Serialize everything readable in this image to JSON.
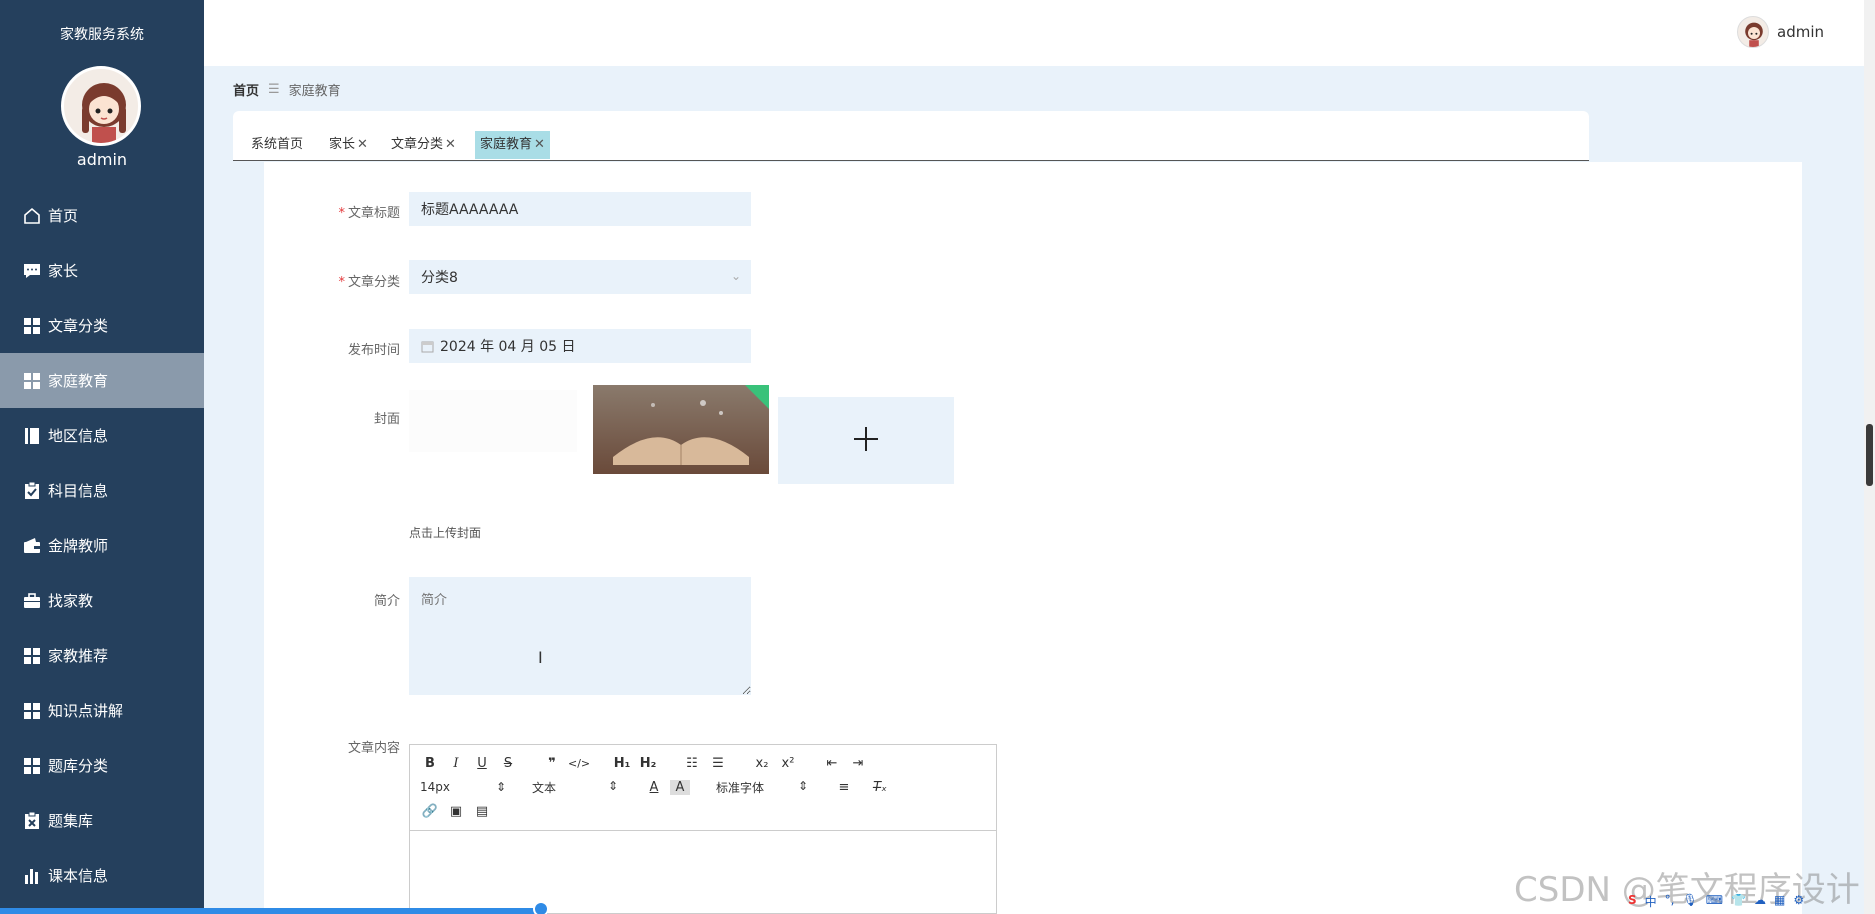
{
  "sidebar": {
    "title": "家教服务系统",
    "username": "admin",
    "items": [
      {
        "label": "首页",
        "icon": "home-icon"
      },
      {
        "label": "家长",
        "icon": "chat-icon"
      },
      {
        "label": "文章分类",
        "icon": "grid-icon"
      },
      {
        "label": "家庭教育",
        "icon": "grid-icon",
        "active": true
      },
      {
        "label": "地区信息",
        "icon": "book-icon"
      },
      {
        "label": "科目信息",
        "icon": "clipboard-check-icon"
      },
      {
        "label": "金牌教师",
        "icon": "wallet-icon"
      },
      {
        "label": "找家教",
        "icon": "briefcase-icon"
      },
      {
        "label": "家教推荐",
        "icon": "grid-icon"
      },
      {
        "label": "知识点讲解",
        "icon": "grid-icon"
      },
      {
        "label": "题库分类",
        "icon": "grid-icon"
      },
      {
        "label": "题集库",
        "icon": "clipboard-x-icon"
      },
      {
        "label": "课本信息",
        "icon": "bar-chart-icon"
      }
    ]
  },
  "header": {
    "username": "admin"
  },
  "breadcrumb": {
    "home": "首页",
    "current": "家庭教育"
  },
  "tabs": [
    {
      "label": "系统首页",
      "closable": false
    },
    {
      "label": "家长",
      "closable": true
    },
    {
      "label": "文章分类",
      "closable": true
    },
    {
      "label": "家庭教育",
      "closable": true,
      "active": true
    }
  ],
  "form": {
    "title_label": "文章标题",
    "title_value": "标题AAAAAAA",
    "category_label": "文章分类",
    "category_value": "分类8",
    "date_label": "发布时间",
    "date_value": "2024 年 04 月 05 日",
    "cover_label": "封面",
    "cover_hint": "点击上传封面",
    "summary_label": "简介",
    "summary_placeholder": "简介",
    "content_label": "文章内容"
  },
  "editor": {
    "font_size": "14px",
    "format": "文本",
    "font_family": "标准字体"
  },
  "watermark": "CSDN @笔文程序设计",
  "tray_items": [
    "中"
  ],
  "colors": {
    "sidebar_bg": "#25405d",
    "active_menu": "#8a9aab",
    "active_tab": "#a9dde6",
    "field_bg": "#e9f2fa"
  }
}
